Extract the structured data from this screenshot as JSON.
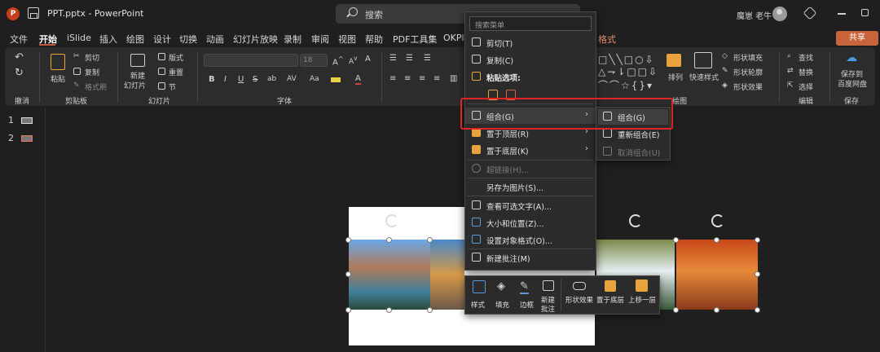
{
  "titlebar": {
    "app_title": "PPT.pptx  -  PowerPoint",
    "search_placeholder": "搜索",
    "user_name": "魔崽 老牛"
  },
  "tabs": [
    {
      "label": "文件"
    },
    {
      "label": "开始",
      "active": true
    },
    {
      "label": "iSlide"
    },
    {
      "label": "插入"
    },
    {
      "label": "绘图"
    },
    {
      "label": "设计"
    },
    {
      "label": "切换"
    },
    {
      "label": "动画"
    },
    {
      "label": "幻灯片放映"
    },
    {
      "label": "录制"
    },
    {
      "label": "审阅"
    },
    {
      "label": "视图"
    },
    {
      "label": "帮助"
    },
    {
      "label": "PDF工具集"
    },
    {
      "label": "OKPl"
    },
    {
      "label": "格式"
    }
  ],
  "share_label": "共享",
  "ribbon": {
    "groups": {
      "undo": "撤消",
      "clipboard": "剪贴板",
      "slides": "幻灯片",
      "font": "字体",
      "drawing": "绘图",
      "editing": "编辑",
      "save": "保存"
    },
    "clipboard": {
      "paste": "粘贴",
      "cut": "剪切",
      "copy": "复制",
      "format_painter": "格式刷"
    },
    "slides": {
      "new_slide_1": "新建",
      "new_slide_2": "幻灯片",
      "layout": "版式",
      "reset": "重置",
      "section": "节"
    },
    "font": {
      "size": "18",
      "bold": "B",
      "italic": "I",
      "underline": "U",
      "strike": "S",
      "shadow": "ab",
      "spacing": "AV",
      "case": "Aa",
      "color": "A"
    },
    "drawing": {
      "arrange": "排列",
      "quick_styles": "快速样式",
      "shape_fill": "形状填充",
      "shape_outline": "形状轮廓",
      "shape_effects": "形状效果"
    },
    "editing": {
      "find": "查找",
      "replace": "替换",
      "select": "选择"
    },
    "save": {
      "line1": "保存到",
      "line2": "百度网盘"
    }
  },
  "thumbnails": [
    {
      "num": "1"
    },
    {
      "num": "2"
    }
  ],
  "context_menu": {
    "search_placeholder": "搜索菜单",
    "items": {
      "cut": "剪切(T)",
      "copy": "复制(C)",
      "paste_options": "粘贴选项:",
      "group": "组合(G)",
      "bring_front": "置于顶层(R)",
      "send_back": "置于底层(K)",
      "hyperlink": "超链接(H)...",
      "save_picture": "另存为图片(S)...",
      "alt_text": "查看可选文字(A)...",
      "size_position": "大小和位置(Z)...",
      "format_object": "设置对象格式(O)...",
      "new_comment": "新建批注(M)"
    }
  },
  "submenu": {
    "group": "组合(G)",
    "regroup": "重新组合(E)",
    "ungroup": "取消组合(U)"
  },
  "mini_toolbar": {
    "style": "样式",
    "fill": "填充",
    "border": "边框",
    "new_comment_1": "新建",
    "new_comment_2": "批注",
    "shape_effects": "形状效果",
    "send_back": "置于底层",
    "bring_forward": "上移一层"
  },
  "colors": {
    "accent": "#c55a3a",
    "highlight_box": "#e02424",
    "shape_orange": "#e8a33c"
  }
}
